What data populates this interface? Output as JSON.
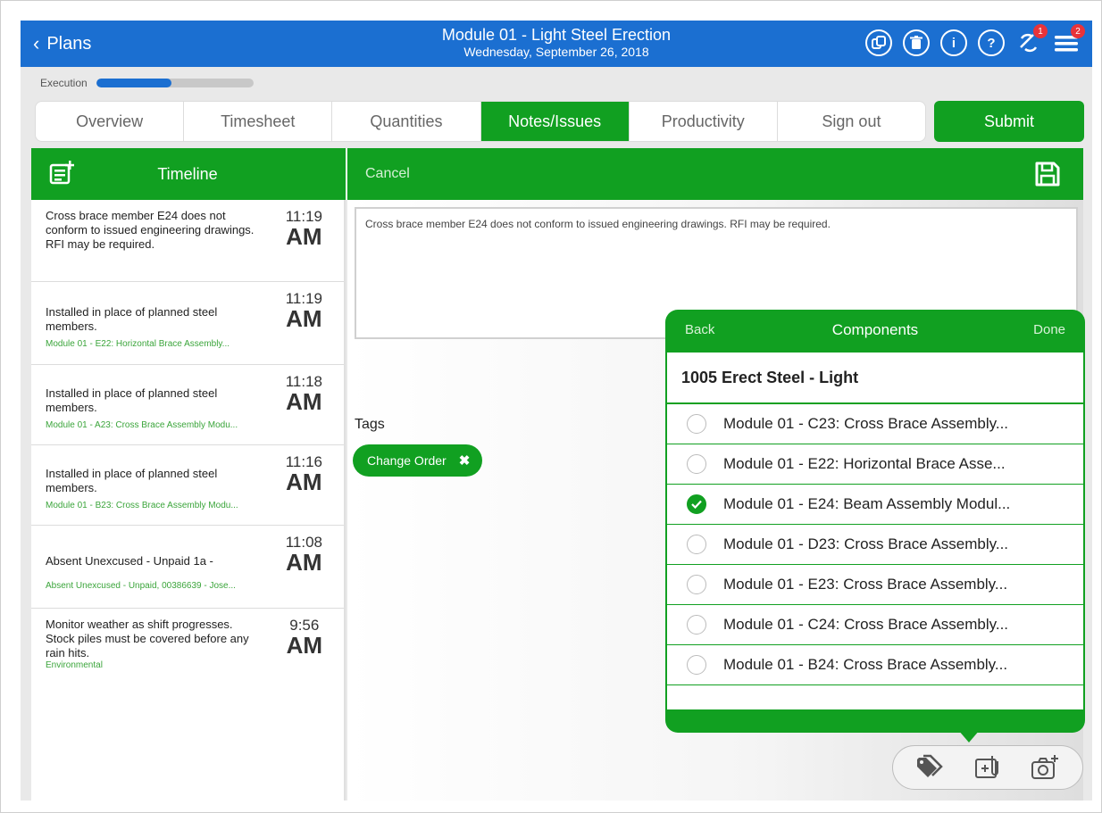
{
  "header": {
    "back_label": "Plans",
    "title": "Module 01 - Light Steel Erection",
    "date": "Wednesday, September 26, 2018",
    "icons": [
      "copy-icon",
      "trash-icon",
      "info-icon",
      "help-icon",
      "sync-icon",
      "menu-icon"
    ],
    "sync_badge": "1",
    "menu_badge": "2"
  },
  "execution": {
    "label": "Execution",
    "progress_percent": 48
  },
  "tabs": [
    {
      "label": "Overview",
      "active": false
    },
    {
      "label": "Timesheet",
      "active": false
    },
    {
      "label": "Quantities",
      "active": false
    },
    {
      "label": "Notes/Issues",
      "active": true
    },
    {
      "label": "Productivity",
      "active": false
    },
    {
      "label": "Sign out",
      "active": false
    }
  ],
  "submit_label": "Submit",
  "timeline": {
    "title": "Timeline",
    "items": [
      {
        "text": "Cross brace member E24 does not conform to issued engineering drawings. RFI may be required.",
        "sub": "",
        "time": "11:19",
        "ampm": "AM"
      },
      {
        "text": "Installed in place of planned steel members.",
        "sub": "Module 01 - E22: Horizontal Brace Assembly...",
        "time": "11:19",
        "ampm": "AM"
      },
      {
        "text": "Installed in place of planned steel members.",
        "sub": "Module 01 - A23: Cross Brace Assembly Modu...",
        "time": "11:18",
        "ampm": "AM"
      },
      {
        "text": "Installed in place of planned steel members.",
        "sub": "Module 01 - B23: Cross Brace Assembly Modu...",
        "time": "11:16",
        "ampm": "AM"
      },
      {
        "text": "Absent Unexcused - Unpaid 1a -",
        "sub": "Absent Unexcused - Unpaid, 00386639 - Jose...",
        "time": "11:08",
        "ampm": "AM"
      },
      {
        "text": "Monitor weather as shift progresses. Stock piles must be covered before any rain hits.",
        "sub": "Environmental",
        "time": "9:56",
        "ampm": "AM"
      }
    ]
  },
  "editor": {
    "cancel_label": "Cancel",
    "note_text": "Cross brace member E24 does not conform to issued engineering drawings. RFI may be required.",
    "tags_label": "Tags",
    "tags": [
      "Change Order"
    ]
  },
  "components": {
    "back_label": "Back",
    "title": "Components",
    "done_label": "Done",
    "group": "1005 Erect Steel - Light",
    "items": [
      {
        "label": "Module 01 - C23: Cross Brace Assembly...",
        "checked": false
      },
      {
        "label": "Module 01 - E22: Horizontal Brace Asse...",
        "checked": false
      },
      {
        "label": "Module 01 - E24: Beam Assembly Modul...",
        "checked": true
      },
      {
        "label": "Module 01 - D23: Cross Brace Assembly...",
        "checked": false
      },
      {
        "label": "Module 01 - E23: Cross Brace Assembly...",
        "checked": false
      },
      {
        "label": "Module 01 - C24: Cross Brace Assembly...",
        "checked": false
      },
      {
        "label": "Module 01 - B24: Cross Brace Assembly...",
        "checked": false
      }
    ]
  },
  "actions": [
    "tag-icon",
    "attach-icon",
    "camera-add-icon"
  ],
  "colors": {
    "nav_blue": "#1b6fd1",
    "green": "#11a021",
    "badge_red": "#e8333a"
  }
}
